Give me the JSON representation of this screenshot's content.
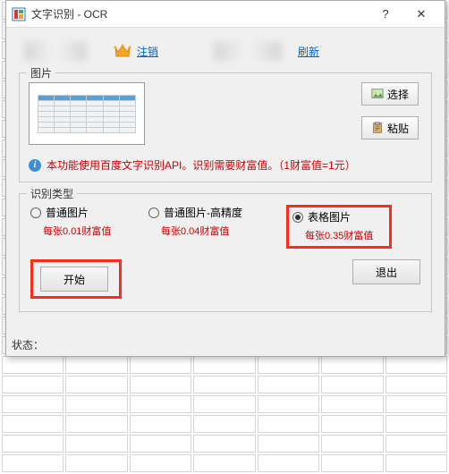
{
  "window": {
    "title": "文字识别 - OCR",
    "help": "?",
    "close": "✕"
  },
  "top": {
    "logout": "注销",
    "refresh": "刷新"
  },
  "picGroup": {
    "legend": "图片",
    "select": "选择",
    "paste": "粘贴",
    "info": "本功能使用百度文字识别API。识别需要财富值。（1财富值=1元）"
  },
  "typeGroup": {
    "legend": "识别类型",
    "options": [
      {
        "label": "普通图片",
        "price": "每张0.01财富值",
        "checked": false
      },
      {
        "label": "普通图片-高精度",
        "price": "每张0.04财富值",
        "checked": false
      },
      {
        "label": "表格图片",
        "price": "每张0.35财富值",
        "checked": true
      }
    ]
  },
  "buttons": {
    "start": "开始",
    "exit": "退出"
  },
  "status": "状态："
}
